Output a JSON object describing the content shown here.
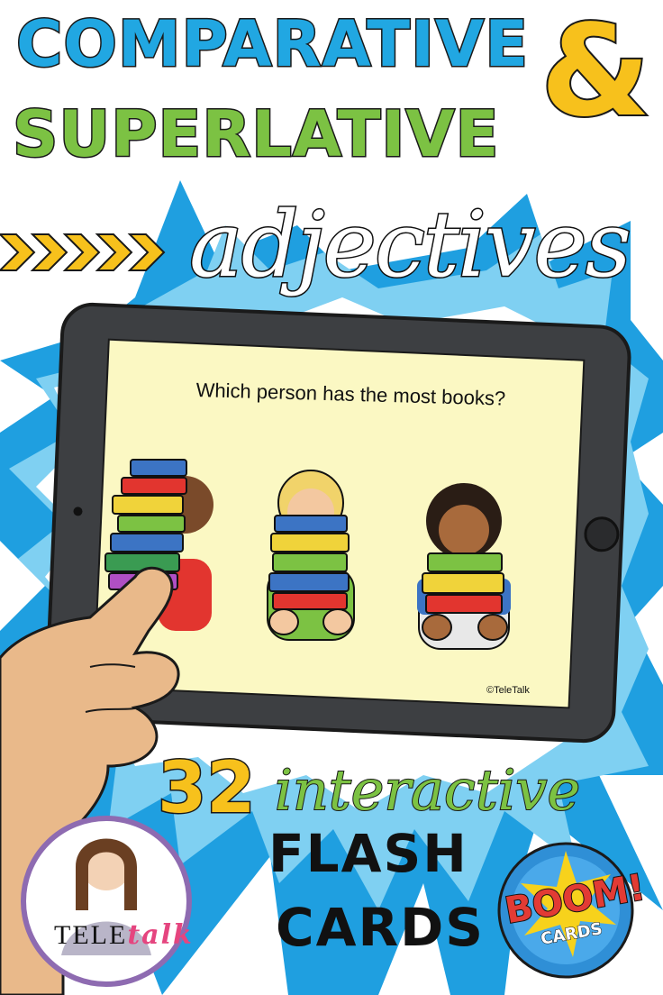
{
  "title": {
    "line1": "COMPARATIVE",
    "ampersand": "&",
    "line2": "SUPERLATIVE",
    "line3": "adjectives"
  },
  "tablet": {
    "question": "Which person has the most books?",
    "credit": "©TeleTalk"
  },
  "footer": {
    "count": "32",
    "interactive": "interactive",
    "flash": "FLASH",
    "cards": "CARDS"
  },
  "brand": {
    "tele": "TELE",
    "talk": "talk"
  },
  "boom": {
    "main": "BOOM!",
    "sub": "CARDS"
  },
  "colors": {
    "blue": "#21a7e2",
    "green": "#7cc243",
    "yellow": "#f7c11c",
    "screen": "#fbf8c3",
    "tablet": "#3d3f42"
  }
}
